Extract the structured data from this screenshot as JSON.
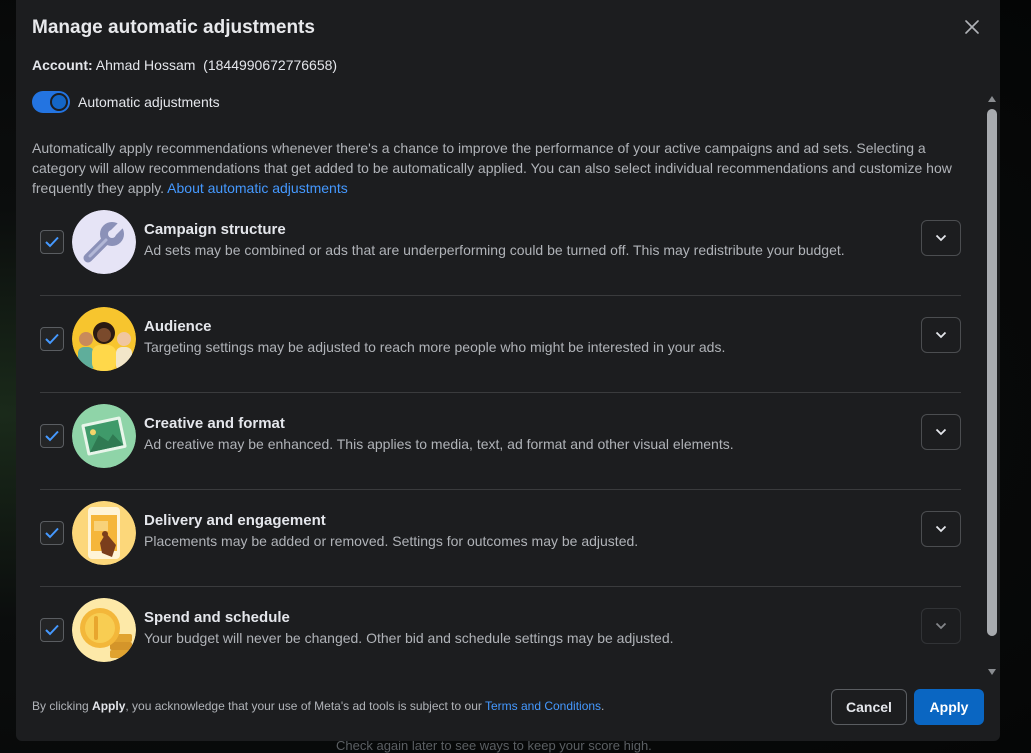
{
  "background": {
    "bottom_text": "Check again later to see ways to keep your score high."
  },
  "modal": {
    "title": "Manage automatic adjustments",
    "close_icon": "close-icon",
    "account_label": "Account:",
    "account_value": "Ahmad Hossam  (1844990672776658)",
    "toggle": {
      "label": "Automatic adjustments",
      "on": true
    },
    "description": "Automatically apply recommendations whenever there's a chance to improve the performance of your active campaigns and ad sets. Selecting a category will allow recommendations that get added to be automatically applied. You can also select individual recommendations and customize how frequently they apply.",
    "description_link": "About automatic adjustments",
    "categories": [
      {
        "title": "Campaign structure",
        "description": "Ad sets may be combined or ads that are underperforming could be turned off. This may redistribute your budget.",
        "checked": true,
        "icon": "wrench-icon"
      },
      {
        "title": "Audience",
        "description": "Targeting settings may be adjusted to reach more people who might be interested in your ads.",
        "checked": true,
        "icon": "people-icon"
      },
      {
        "title": "Creative and format",
        "description": "Ad creative may be enhanced. This applies to media, text, ad format and other visual elements.",
        "checked": true,
        "icon": "image-icon"
      },
      {
        "title": "Delivery and engagement",
        "description": "Placements may be added or removed. Settings for outcomes may be adjusted.",
        "checked": true,
        "icon": "tap-icon"
      },
      {
        "title": "Spend and schedule",
        "description": "Your budget will never be changed. Other bid and schedule settings may be adjusted.",
        "checked": true,
        "icon": "coins-icon"
      }
    ],
    "footer": {
      "text_before": "By clicking ",
      "text_bold": "Apply",
      "text_after": ", you acknowledge that your use of Meta's ad tools is subject to our ",
      "link": "Terms and Conditions",
      "text_end": "."
    },
    "cancel_label": "Cancel",
    "apply_label": "Apply"
  },
  "colors": {
    "accent": "#0a66c2",
    "link": "#4599ff",
    "checkbox_check": "#4599ff"
  }
}
